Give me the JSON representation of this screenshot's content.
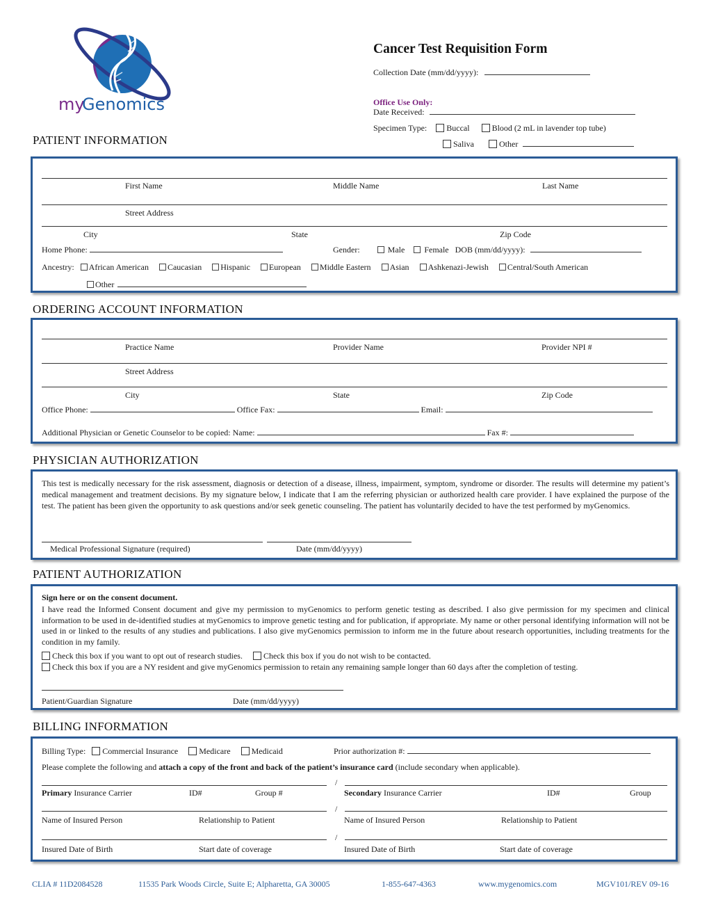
{
  "brand": {
    "name_part1": "my",
    "name_part2": "Genomics",
    "colors": {
      "purple": "#7a2b8a",
      "blue": "#1f6fb5",
      "navy": "#2b3a8a"
    }
  },
  "header": {
    "title": "Cancer Test Requisition Form",
    "collection_date_label": "Collection Date (mm/dd/yyyy):",
    "office_use_label": "Office Use Only:",
    "date_received_label": "Date Received:",
    "specimen_type_label": "Specimen Type:",
    "specimen_options": [
      "Buccal",
      "Blood (2 mL in lavender top tube)",
      "Saliva",
      "Other"
    ]
  },
  "sections": {
    "patient_info": "PATIENT INFORMATION",
    "ordering_account": "ORDERING ACCOUNT INFORMATION",
    "physician_auth": "PHYSICIAN AUTHORIZATION",
    "patient_auth": "PATIENT AUTHORIZATION",
    "billing": "BILLING INFORMATION"
  },
  "patient": {
    "first_name": "First Name",
    "middle_name": "Middle Name",
    "last_name": "Last Name",
    "street": "Street Address",
    "city": "City",
    "state": "State",
    "zip": "Zip Code",
    "home_phone": "Home Phone:",
    "gender_label": "Gender:",
    "gender_male": "Male",
    "gender_female": "Female",
    "dob": "DOB (mm/dd/yyyy):",
    "ancestry_label": "Ancestry:",
    "ancestry_options": [
      "African American",
      "Caucasian",
      "Hispanic",
      "European",
      "Middle Eastern",
      "Asian",
      "Ashkenazi-Jewish",
      "Central/South American",
      "Other"
    ]
  },
  "ordering": {
    "practice_name": "Practice Name",
    "provider_name": "Provider Name",
    "provider_npi": "Provider NPI #",
    "street": "Street Address",
    "city": "City",
    "state": "State",
    "zip": "Zip Code",
    "office_phone": "Office Phone:",
    "office_fax": "Office Fax:",
    "email": "Email:",
    "additional": "Additional Physician or Genetic Counselor to be copied: Name:",
    "fax": "Fax #:"
  },
  "physician": {
    "text": "This test is medically necessary for the risk assessment, diagnosis or detection of a disease, illness, impairment, symptom, syndrome or disorder. The results will determine my patient’s medical management and treatment decisions. By my signature below, I indicate that I am the referring physician or authorized health care provider. I have explained the purpose of the test. The patient has been given the opportunity to ask questions and/or seek genetic counseling. The patient has voluntarily decided to have the test performed by myGenomics.",
    "signature_label": "Medical Professional Signature (required)",
    "date_label": "Date (mm/dd/yyyy)"
  },
  "patient_authorization": {
    "heading": "Sign here or on the consent document.",
    "text": "I have read the Informed Consent document and give my permission to myGenomics to perform genetic testing as described. I also give permission for my specimen and clinical information to be used in de-identified studies at myGenomics to improve genetic testing and for publication, if appropriate. My name or other personal identifying information will not be used in or linked to the results of any studies and publications. I also give myGenomics permission to inform me in the future about research opportunities, including treatments for the condition in my family.",
    "opt_out": "Check this box if you want to opt out of research studies.",
    "no_contact": "Check this box if you do not wish to be contacted.",
    "ny_resident": "Check this box if you are a NY resident and give myGenomics permission to retain any remaining sample longer than 60 days after the completion of testing.",
    "signature_label": "Patient/Guardian Signature",
    "date_label": "Date (mm/dd/yyyy)"
  },
  "billing": {
    "type_label": "Billing Type:",
    "types": [
      "Commercial Insurance",
      "Medicare",
      "Medicaid"
    ],
    "prior_auth": "Prior authorization #:",
    "instruction_pre": "Please complete the following and ",
    "instruction_bold": "attach a copy of the front and back of the patient’s insurance card",
    "instruction_post": " (include secondary when applicable).",
    "slash": "/",
    "primary_bold": "Primary",
    "primary_carrier": " Insurance Carrier",
    "id": "ID#",
    "group_num": "Group #",
    "secondary_bold": "Secondary",
    "secondary_carrier": " Insurance Carrier",
    "group": "Group",
    "insured_name": "Name of Insured Person",
    "relationship": "Relationship to Patient",
    "insured_dob": "Insured Date of Birth",
    "start_date": "Start date of coverage"
  },
  "footer": {
    "clia": "CLIA # 11D2084528",
    "address": "11535 Park Woods Circle, Suite E; Alpharetta, GA 30005",
    "phone": "1-855-647-4363",
    "website": "www.mygenomics.com",
    "revision": "MGV101/REV 09-16"
  }
}
